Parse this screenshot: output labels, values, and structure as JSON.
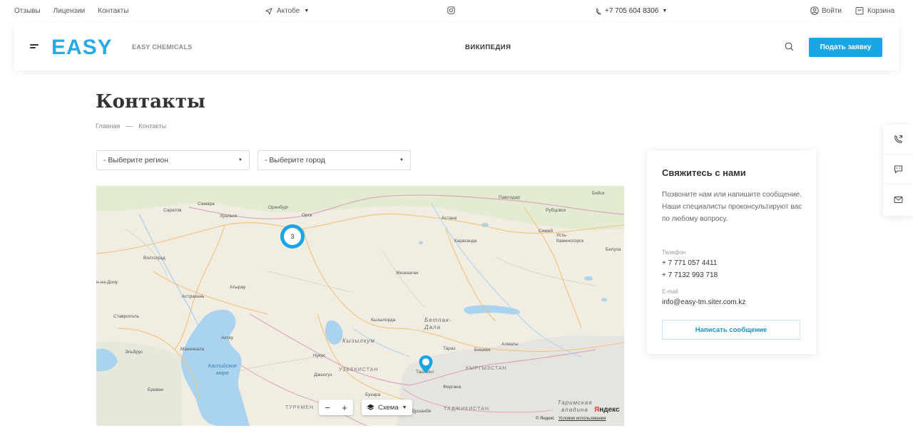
{
  "topbar": {
    "links": [
      "Отзывы",
      "Лицензии",
      "Контакты"
    ],
    "city": "Актобе",
    "phone": "+7 705 604 8306",
    "login": "Войти",
    "cart": "Корзина"
  },
  "header": {
    "logo": "EASY",
    "logo_sub": "EASY CHEMICALS",
    "nav": [
      "ВИКИПЕДИЯ"
    ],
    "cta": "Подать заявку"
  },
  "page": {
    "title": "Контакты",
    "breadcrumbs": [
      "Главная",
      "Контакты"
    ]
  },
  "filters": {
    "region": "- Выберите регион",
    "city": "- Выберите город"
  },
  "map": {
    "cluster_count": "3",
    "scheme_label": "Схема",
    "brand": "Яндекс",
    "copyright": "© Яндекс",
    "terms": "Условия использования",
    "labels": {
      "saratov": "Саратов",
      "samara": "Самара",
      "uralsk": "Уральск",
      "orenburg": "Оренбург",
      "orsk": "Орск",
      "astana": "Астана",
      "pavlodar": "Павлодар",
      "rubtsovsk": "Рубцовск",
      "semey": "Семей",
      "ust": "Усть-Каменогорск",
      "karaganda": "Караганда",
      "volgograd": "Волгоград",
      "astrakhan": "Астрахань",
      "atyrau": "Атырау",
      "zhezkazgan": "Жезказган",
      "stavropol": "Ставрополь",
      "aktau": "Актау",
      "kyzylorda": "Кызылорда",
      "betpak": "Бетпак-Дала",
      "kyzylkum": "Кызылкум",
      "nukus": "Нукус",
      "uzbekistan": "УЗБЕКИСТАН",
      "taraz": "Тараз",
      "bishkek": "Бишкек",
      "almaty": "Алматы",
      "tashkent": "Ташкент",
      "kyrgyzstan": "КЫРГЫЗСТАН",
      "caspian": "Каспийское море",
      "elbrus": "Эльбрус",
      "makhachkala": "Махачкала",
      "yerevan": "Ереван",
      "dashoguz": "Дашогуз",
      "bukhara": "Бухара",
      "fergana": "Фергана",
      "turkmen": "ТУРКМЕН",
      "tajik": "ТАДЖИКИСТАН",
      "dushanbe": "Душанбе",
      "tarim": "Таримская впадина",
      "biysk": "Бийск",
      "belukha": "Белуха",
      "rostov": "н-на-Дону"
    }
  },
  "contact": {
    "title": "Свяжитесь с нами",
    "description": "Позвоните нам или напишите сообщение. Наши специалисты проконсультируют вас по любому вопросу.",
    "phone_label": "Телефон",
    "phones": [
      "+ 7 771 057 4411",
      "+ 7 7132 993 718"
    ],
    "email_label": "E-mail",
    "email": "info@easy-tm.siter.com.kz",
    "button": "Написать сообщение"
  },
  "colors": {
    "accent": "#1aa6e5",
    "logo": "#29aae1",
    "map_land": "#f1ede3",
    "map_water": "#a9d3ee"
  }
}
